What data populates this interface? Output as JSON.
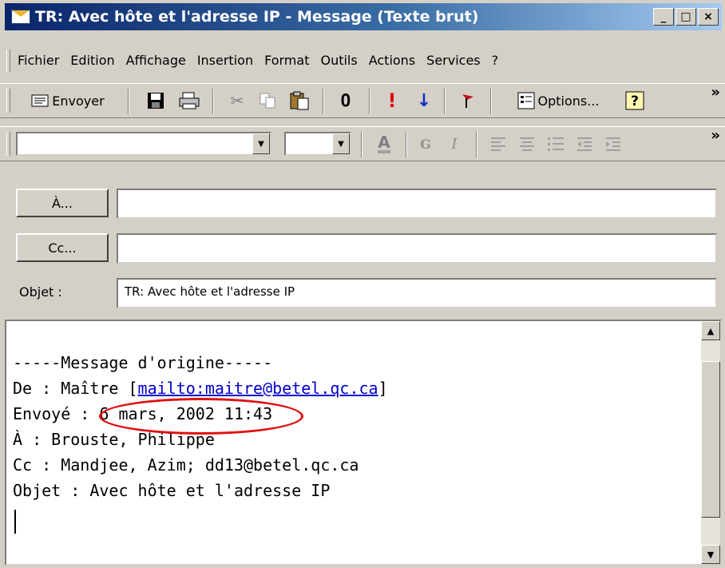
{
  "window": {
    "title": "TR: Avec hôte et l'adresse IP - Message (Texte brut)"
  },
  "win_buttons": {
    "minimize": "_",
    "maximize": "□",
    "close": "×"
  },
  "menu": [
    {
      "label": "Fichier"
    },
    {
      "label": "Edition"
    },
    {
      "label": "Affichage"
    },
    {
      "label": "Insertion"
    },
    {
      "label": "Format"
    },
    {
      "label": "Outils"
    },
    {
      "label": "Actions"
    },
    {
      "label": "Services"
    },
    {
      "label": "?"
    }
  ],
  "toolbar": {
    "send_label": "Envoyer",
    "options_label": "Options...",
    "more_label": "»"
  },
  "icons": {
    "send": "envelope-icon",
    "save": "save-icon",
    "print": "printer-icon",
    "cut": "scissors-icon",
    "copy": "copy-icon",
    "paste": "paste-icon",
    "attach": "paperclip-icon",
    "high_importance": "exclamation-icon",
    "low_importance": "down-arrow-icon",
    "flag": "flag-icon",
    "options": "options-icon",
    "help": "help-icon",
    "font_color": "font-color-icon",
    "bold": "bold-icon",
    "italic": "italic-icon",
    "align_left": "align-left-icon",
    "align_center": "align-center-icon",
    "bullets": "bullets-icon",
    "outdent": "outdent-icon",
    "indent": "indent-icon"
  },
  "format_bar": {
    "font_value": "",
    "size_value": ""
  },
  "header": {
    "to_button": "À...",
    "cc_button": "Cc...",
    "subject_label": "Objet :",
    "to_value": "",
    "cc_value": "",
    "subject_value": "TR: Avec hôte et l'adresse IP"
  },
  "body": {
    "line1": "-----Message d'origine-----",
    "line2_prefix": "De : Maître [",
    "line2_link": "mailto:maitre@betel.qc.ca",
    "line2_suffix": "]",
    "line3": "Envoyé : 6 mars, 2002 11:43",
    "line4": "À : Brouste, Philippe",
    "line5": "Cc : Mandjee, Azim; dd13@betel.qc.ca",
    "line6": "Objet : Avec hôte et l'adresse IP"
  },
  "annotation": {
    "highlight_color": "#e01010"
  }
}
